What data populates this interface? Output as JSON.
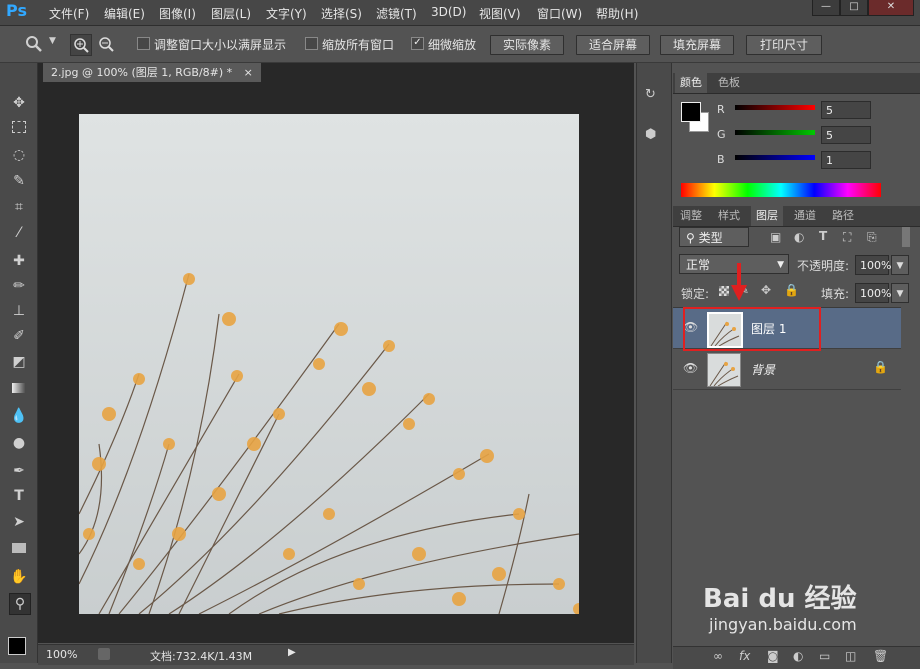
{
  "app": {
    "logo": "Ps"
  },
  "menu": [
    "文件(F)",
    "编辑(E)",
    "图像(I)",
    "图层(L)",
    "文字(Y)",
    "选择(S)",
    "滤镜(T)",
    "3D(D)",
    "视图(V)",
    "窗口(W)",
    "帮助(H)"
  ],
  "window_controls": {
    "minimize": "—",
    "maximize": "□",
    "close": "✕"
  },
  "options": {
    "checkboxes": [
      {
        "label": "调整窗口大小以满屏显示",
        "checked": false
      },
      {
        "label": "缩放所有窗口",
        "checked": false
      },
      {
        "label": "细微缩放",
        "checked": true
      }
    ],
    "buttons": [
      "实际像素",
      "适合屏幕",
      "填充屏幕",
      "打印尺寸"
    ]
  },
  "document": {
    "tab_title": "2.jpg @ 100% (图层 1, RGB/8#) *",
    "close": "×"
  },
  "status": {
    "zoom": "100%",
    "doc_info": "文档:732.4K/1.43M"
  },
  "color_panel": {
    "tabs": [
      "颜色",
      "色板"
    ],
    "channels": [
      {
        "label": "R",
        "value": "5",
        "color": "#ff0000"
      },
      {
        "label": "G",
        "value": "5",
        "color": "#00c800"
      },
      {
        "label": "B",
        "value": "1",
        "color": "#0000ff"
      }
    ]
  },
  "layers_panel": {
    "tabs": [
      "调整",
      "样式",
      "图层",
      "通道",
      "路径"
    ],
    "filter_kind": "类型",
    "blend_mode": "正常",
    "opacity_label": "不透明度:",
    "opacity_value": "100%",
    "lock_label": "锁定:",
    "fill_label": "填充:",
    "fill_value": "100%",
    "layers": [
      {
        "name": "图层 1",
        "selected": true
      },
      {
        "name": "背景",
        "selected": false,
        "locked": true
      }
    ],
    "bottom_icons": [
      "link-icon",
      "fx-icon",
      "mask-icon",
      "adjustment-icon",
      "group-icon",
      "new-layer-icon",
      "trash-icon"
    ]
  },
  "watermark": {
    "brand": "Bai du 经验",
    "url": "jingyan.baidu.com"
  },
  "colors": {
    "accent": "#31a8ff",
    "highlight": "#e02020",
    "selected_layer": "#586b87"
  }
}
